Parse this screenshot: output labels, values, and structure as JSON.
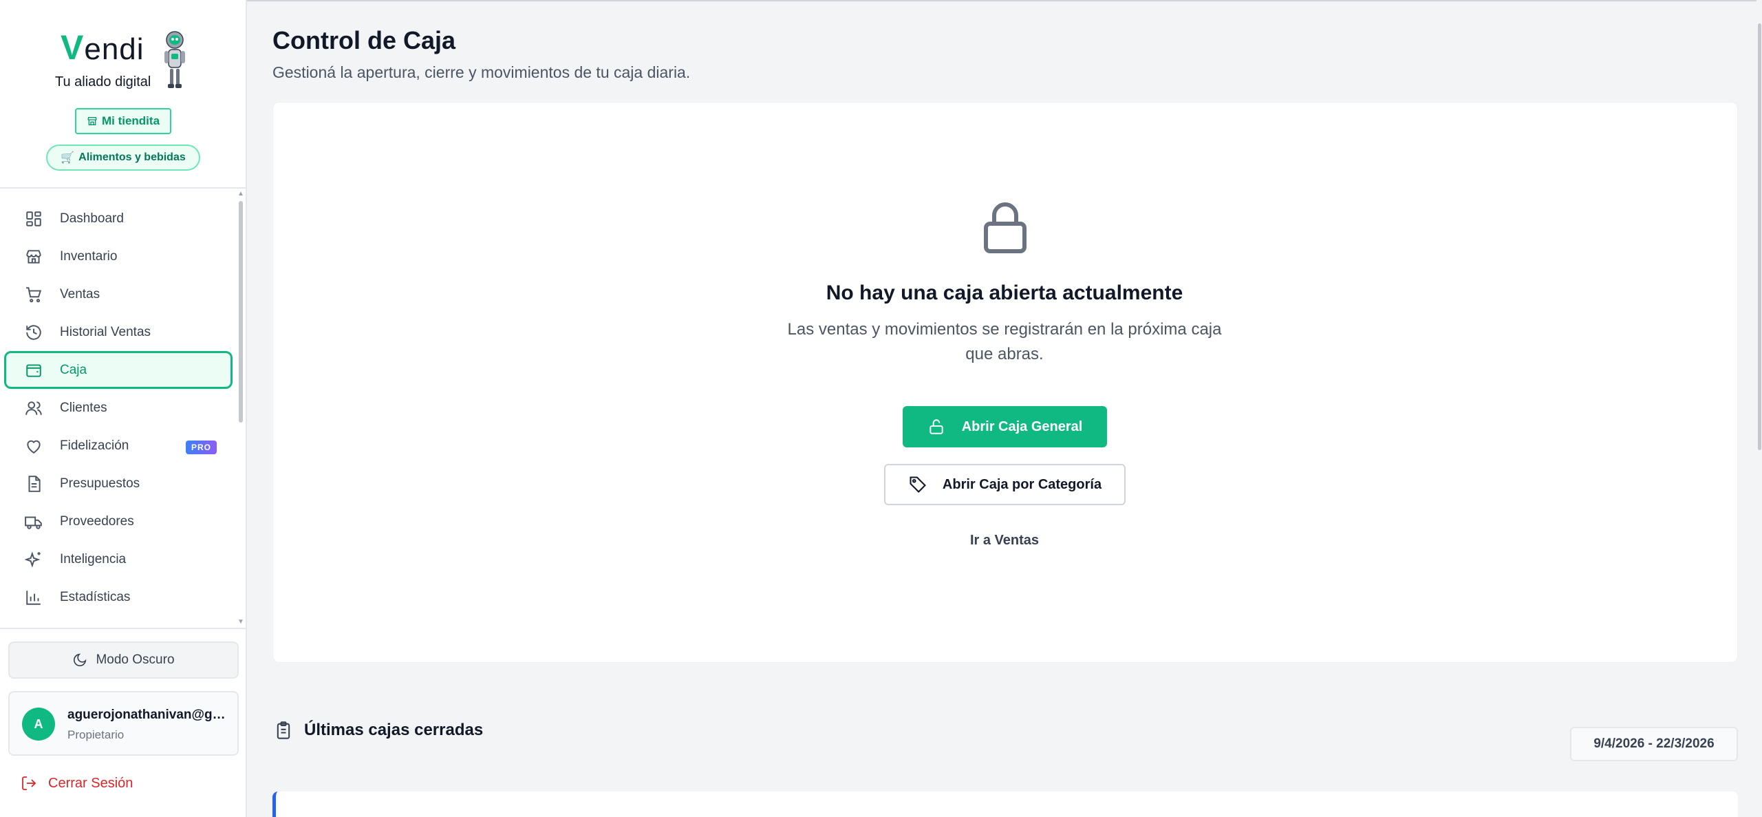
{
  "brand": {
    "name": "endi",
    "initial": "V",
    "tagline": "Tu aliado digital"
  },
  "store": {
    "name_label": "Mi tiendita",
    "category_label": "Alimentos y bebidas"
  },
  "nav": {
    "items": [
      {
        "label": "Dashboard",
        "icon": "dashboard-icon"
      },
      {
        "label": "Inventario",
        "icon": "store-icon"
      },
      {
        "label": "Ventas",
        "icon": "cart-icon"
      },
      {
        "label": "Historial Ventas",
        "icon": "history-icon"
      },
      {
        "label": "Caja",
        "icon": "wallet-icon",
        "active": true
      },
      {
        "label": "Clientes",
        "icon": "users-icon"
      },
      {
        "label": "Fidelización",
        "icon": "heart-icon",
        "badge": "PRO"
      },
      {
        "label": "Presupuestos",
        "icon": "document-icon"
      },
      {
        "label": "Proveedores",
        "icon": "truck-icon"
      },
      {
        "label": "Inteligencia",
        "icon": "sparkles-icon"
      },
      {
        "label": "Estadísticas",
        "icon": "chart-icon"
      }
    ]
  },
  "footer": {
    "dark_mode_label": "Modo Oscuro",
    "user": {
      "initial": "A",
      "email": "aguerojonathanivan@gmail.com",
      "role": "Propietario"
    },
    "logout_label": "Cerrar Sesión"
  },
  "page": {
    "title": "Control de Caja",
    "subtitle": "Gestioná la apertura, cierre y movimientos de tu caja diaria."
  },
  "empty_state": {
    "title": "No hay una caja abierta actualmente",
    "description": "Las ventas y movimientos se registrarán en la próxima caja que abras.",
    "open_general_label": "Abrir Caja General",
    "open_category_label": "Abrir Caja por Categoría",
    "go_sales_label": "Ir a Ventas"
  },
  "closed_registers": {
    "title": "Últimas cajas cerradas",
    "date_range": "9/4/2026 - 22/3/2026"
  },
  "colors": {
    "accent": "#10b981",
    "danger": "#dc2626",
    "pro_badge": "#6366f1",
    "highlight_border": "#2563eb"
  }
}
